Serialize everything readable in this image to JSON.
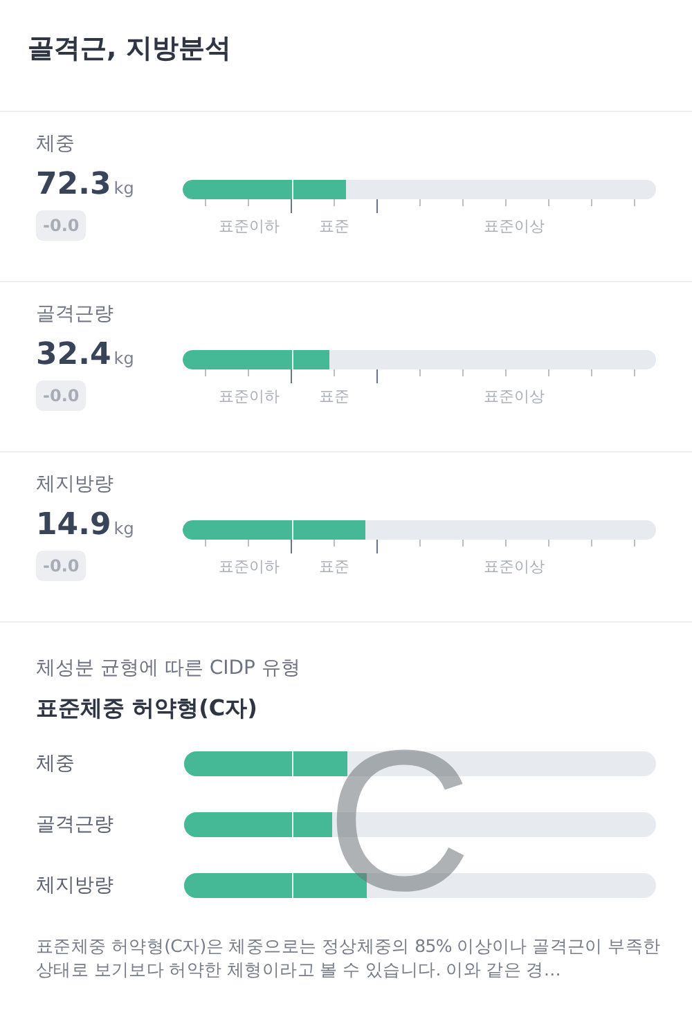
{
  "header": {
    "title": "골격근, 지방분석"
  },
  "metrics": [
    {
      "name": "체중",
      "value": "72.3",
      "unit": "kg",
      "change": "-0.0",
      "level": 0.345,
      "scale_labels": [
        "표준이하",
        "표준",
        "표준이상"
      ]
    },
    {
      "name": "골격근량",
      "value": "32.4",
      "unit": "kg",
      "change": "-0.0",
      "level": 0.31,
      "scale_labels": [
        "표준이하",
        "표준",
        "표준이상"
      ]
    },
    {
      "name": "체지방량",
      "value": "14.9",
      "unit": "kg",
      "change": "-0.0",
      "level": 0.386,
      "scale_labels": [
        "표준이하",
        "표준",
        "표준이상"
      ]
    }
  ],
  "cidp": {
    "subtitle": "체성분 균형에 따른 CIDP 유형",
    "type_title": "표준체중 허약형(C자)",
    "shape_letter": "C",
    "rows": [
      {
        "name": "체중",
        "level": 0.345
      },
      {
        "name": "골격근량",
        "level": 0.313
      },
      {
        "name": "체지방량",
        "level": 0.386
      }
    ],
    "description": "표준체중 허약형(C자)은 체중으로는 정상체중의 85% 이상이나 골격근이 부족한 상태로 보기보다 허약한 체형이라고 볼 수 있습니다. 이와 같은 경…"
  }
}
